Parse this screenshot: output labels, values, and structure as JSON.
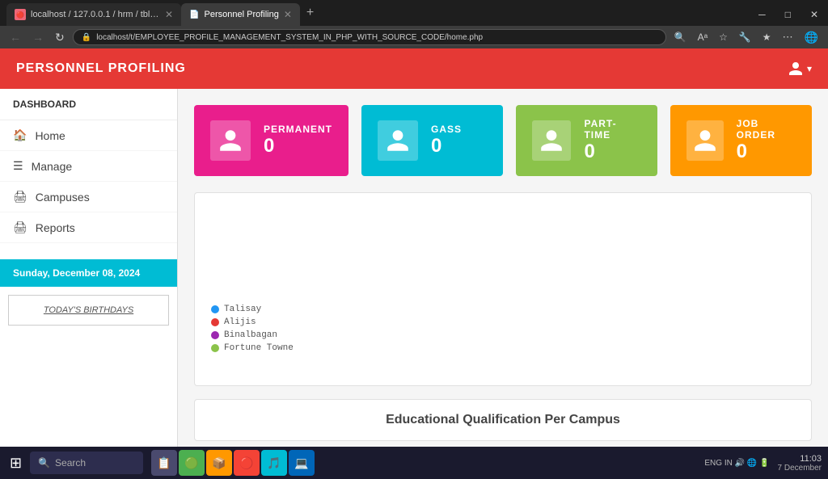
{
  "browser": {
    "tabs": [
      {
        "id": "tab1",
        "favicon": "🔴",
        "label": "localhost / 127.0.0.1 / hrm / tbl_p...",
        "active": false,
        "closable": true
      },
      {
        "id": "tab2",
        "favicon": "📄",
        "label": "Personnel Profiling",
        "active": true,
        "closable": true
      }
    ],
    "new_tab_label": "+",
    "address": "localhost/t/EMPLOYEE_PROFILE_MANAGEMENT_SYSTEM_IN_PHP_WITH_SOURCE_CODE/home.php",
    "nav": {
      "back": "←",
      "forward": "→",
      "refresh": "↻"
    }
  },
  "app": {
    "title": "PERSONNEL PROFILING",
    "user_icon": "👤"
  },
  "sidebar": {
    "header": "DASHBOARD",
    "items": [
      {
        "id": "home",
        "icon": "🏠",
        "label": "Home"
      },
      {
        "id": "manage",
        "icon": "☰",
        "label": "Manage"
      },
      {
        "id": "campuses",
        "icon": "🖨",
        "label": "Campuses"
      },
      {
        "id": "reports",
        "icon": "🖨",
        "label": "Reports"
      }
    ],
    "date_label": "Sunday, December 08, 2024",
    "birthday_button": "TODAY'S BIRTHDAYS"
  },
  "stats": [
    {
      "id": "permanent",
      "label": "PERMANENT",
      "value": "0",
      "card_class": "card-permanent"
    },
    {
      "id": "gass",
      "label": "GASS",
      "value": "0",
      "card_class": "card-gass"
    },
    {
      "id": "parttime",
      "label": "PART-TIME",
      "value": "0",
      "card_class": "card-parttime"
    },
    {
      "id": "joborder",
      "label": "JOB ORDER",
      "value": "0",
      "card_class": "card-joborder"
    }
  ],
  "chart": {
    "legend": [
      {
        "label": "Talisay",
        "color": "#2196f3"
      },
      {
        "label": "Alijis",
        "color": "#e53935"
      },
      {
        "label": "Binalbagan",
        "color": "#9c27b0"
      },
      {
        "label": "Fortune Towne",
        "color": "#8bc34a"
      }
    ]
  },
  "bottom_chart": {
    "title": "Educational Qualification Per Campus"
  },
  "taskbar": {
    "search_placeholder": "Search",
    "apps": [
      {
        "id": "app1",
        "icon": "⊞",
        "color": "transparent",
        "label": "windows"
      },
      {
        "id": "app2",
        "icon": "🟢",
        "color": "green",
        "label": "app2"
      },
      {
        "id": "app3",
        "icon": "🔵",
        "color": "blue",
        "label": "app3"
      },
      {
        "id": "app4",
        "icon": "📋",
        "color": "orange",
        "label": "app4"
      },
      {
        "id": "app5",
        "icon": "🔴",
        "color": "red",
        "label": "app5"
      },
      {
        "id": "app6",
        "icon": "🎵",
        "color": "cyan",
        "label": "app6"
      },
      {
        "id": "app7",
        "icon": "💻",
        "color": "vscode",
        "label": "vscode"
      }
    ],
    "time": "11:03",
    "date": "7 December",
    "system_icons": "ENG IN 🔊 🌐 🔋"
  }
}
